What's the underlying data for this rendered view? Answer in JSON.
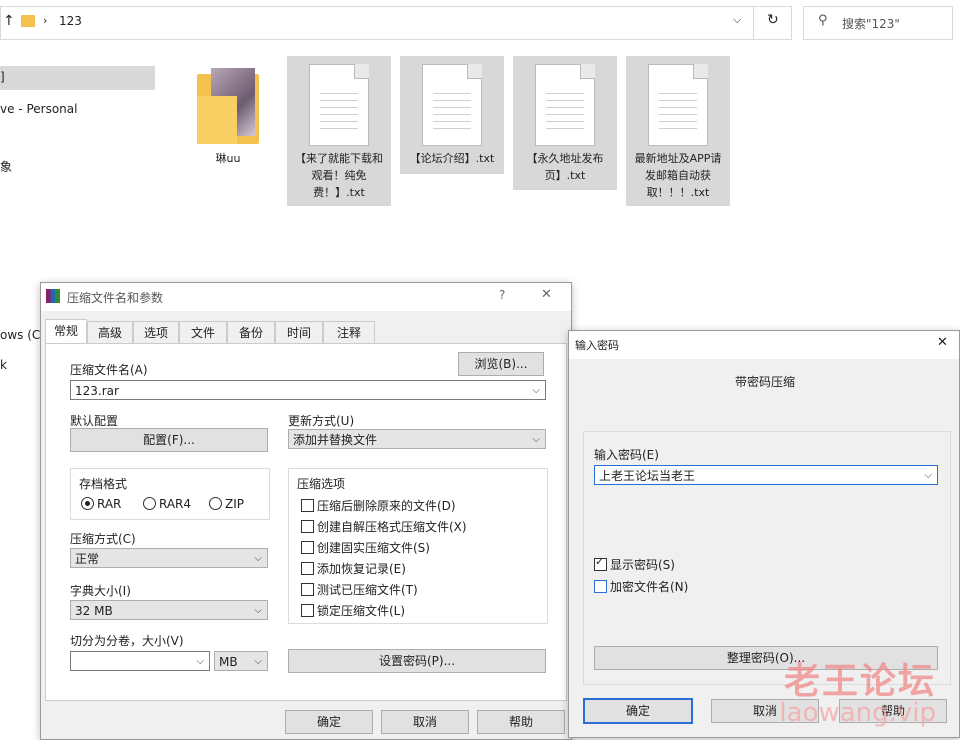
{
  "explorer": {
    "address": {
      "arrow": "↑",
      "path": "123"
    },
    "search": {
      "placeholder": "搜索\"123\""
    },
    "nav": [
      {
        "text": "]"
      },
      {
        "text": "ve - Personal"
      },
      {
        "text": "象"
      },
      {
        "text": "ows (C:)"
      },
      {
        "text": "k"
      }
    ],
    "files": [
      {
        "name": "琳uu",
        "kind": "folder"
      },
      {
        "name": "【来了就能下载和观看！纯免费！】.txt",
        "kind": "txt"
      },
      {
        "name": "【论坛介绍】.txt",
        "kind": "txt"
      },
      {
        "name": "【永久地址发布页】.txt",
        "kind": "txt"
      },
      {
        "name": "最新地址及APP请发邮箱自动获取！！！.txt",
        "kind": "txt"
      }
    ]
  },
  "archive_dialog": {
    "title": "压缩文件名和参数",
    "help": "?",
    "close": "✕",
    "tabs": [
      "常规",
      "高级",
      "选项",
      "文件",
      "备份",
      "时间",
      "注释"
    ],
    "filename_label": "压缩文件名(A)",
    "browse_label": "浏览(B)...",
    "filename_value": "123.rar",
    "default_profile_label": "默认配置",
    "profile_button": "配置(F)...",
    "update_mode_label": "更新方式(U)",
    "update_mode_value": "添加并替换文件",
    "format_label": "存档格式",
    "formats": [
      "RAR",
      "RAR4",
      "ZIP"
    ],
    "options_label": "压缩选项",
    "options": [
      "压缩后删除原来的文件(D)",
      "创建自解压格式压缩文件(X)",
      "创建固实压缩文件(S)",
      "添加恢复记录(E)",
      "测试已压缩文件(T)",
      "锁定压缩文件(L)"
    ],
    "method_label": "压缩方式(C)",
    "method_value": "正常",
    "dict_label": "字典大小(I)",
    "dict_value": "32 MB",
    "split_label": "切分为分卷，大小(V)",
    "split_value": "",
    "split_unit": "MB",
    "set_password": "设置密码(P)...",
    "ok": "确定",
    "cancel": "取消",
    "help_button": "帮助"
  },
  "password_dialog": {
    "title": "输入密码",
    "close": "✕",
    "heading": "带密码压缩",
    "password_label": "输入密码(E)",
    "password_value": "上老王论坛当老王",
    "show_password": "显示密码(S)",
    "encrypt_names": "加密文件名(N)",
    "organize": "整理密码(O)...",
    "ok": "确定",
    "cancel": "取消",
    "help": "帮助"
  },
  "watermark": {
    "cn": "老王论坛",
    "en": "laowang.vip"
  }
}
